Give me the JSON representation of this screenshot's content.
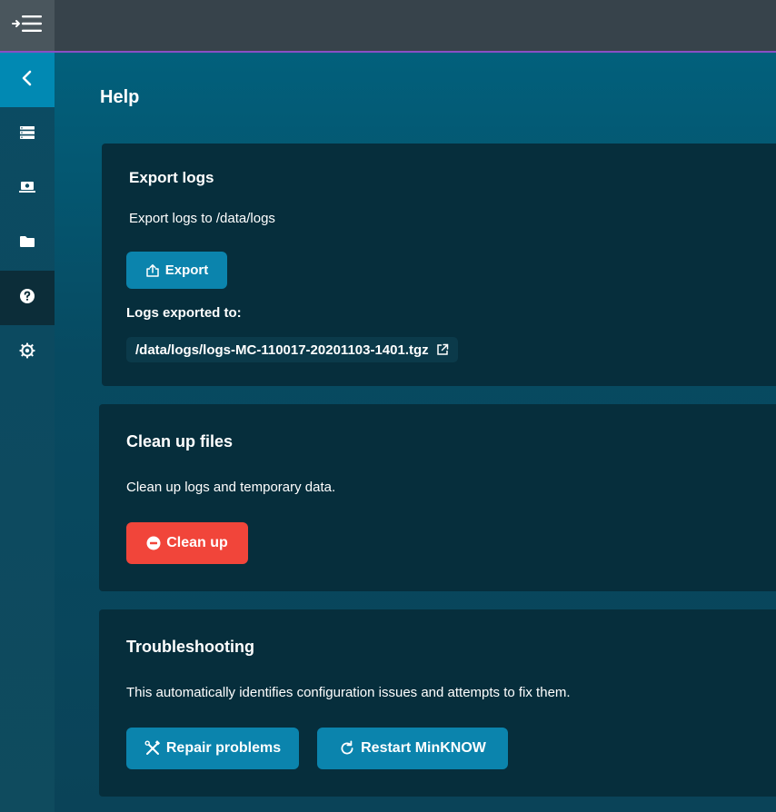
{
  "page": {
    "title": "Help"
  },
  "topbar": {
    "menu_icon": "menu-collapse-icon"
  },
  "sidebar": {
    "items": [
      {
        "icon": "chevron-left-icon",
        "name": "back"
      },
      {
        "icon": "list-icon",
        "name": "experiments"
      },
      {
        "icon": "device-icon",
        "name": "device"
      },
      {
        "icon": "folder-icon",
        "name": "files"
      },
      {
        "icon": "help-icon",
        "name": "help"
      },
      {
        "icon": "settings-icon",
        "name": "settings"
      }
    ]
  },
  "export_logs": {
    "heading": "Export logs",
    "description": "Export logs to /data/logs",
    "button_label": "Export",
    "exported_label": "Logs exported to:",
    "exported_path": "/data/logs/logs-MC-110017-20201103-1401.tgz"
  },
  "cleanup": {
    "heading": "Clean up files",
    "description": "Clean up logs and temporary data.",
    "button_label": "Clean up"
  },
  "troubleshooting": {
    "heading": "Troubleshooting",
    "description": "This automatically identifies configuration issues and attempts to fix them.",
    "repair_label": "Repair problems",
    "restart_label": "Restart MinKNOW"
  },
  "colors": {
    "accent_blue": "#0b84ad",
    "danger_red": "#f1453a",
    "card_bg": "#062e3c",
    "topbar_line": "#8a4fc5"
  }
}
